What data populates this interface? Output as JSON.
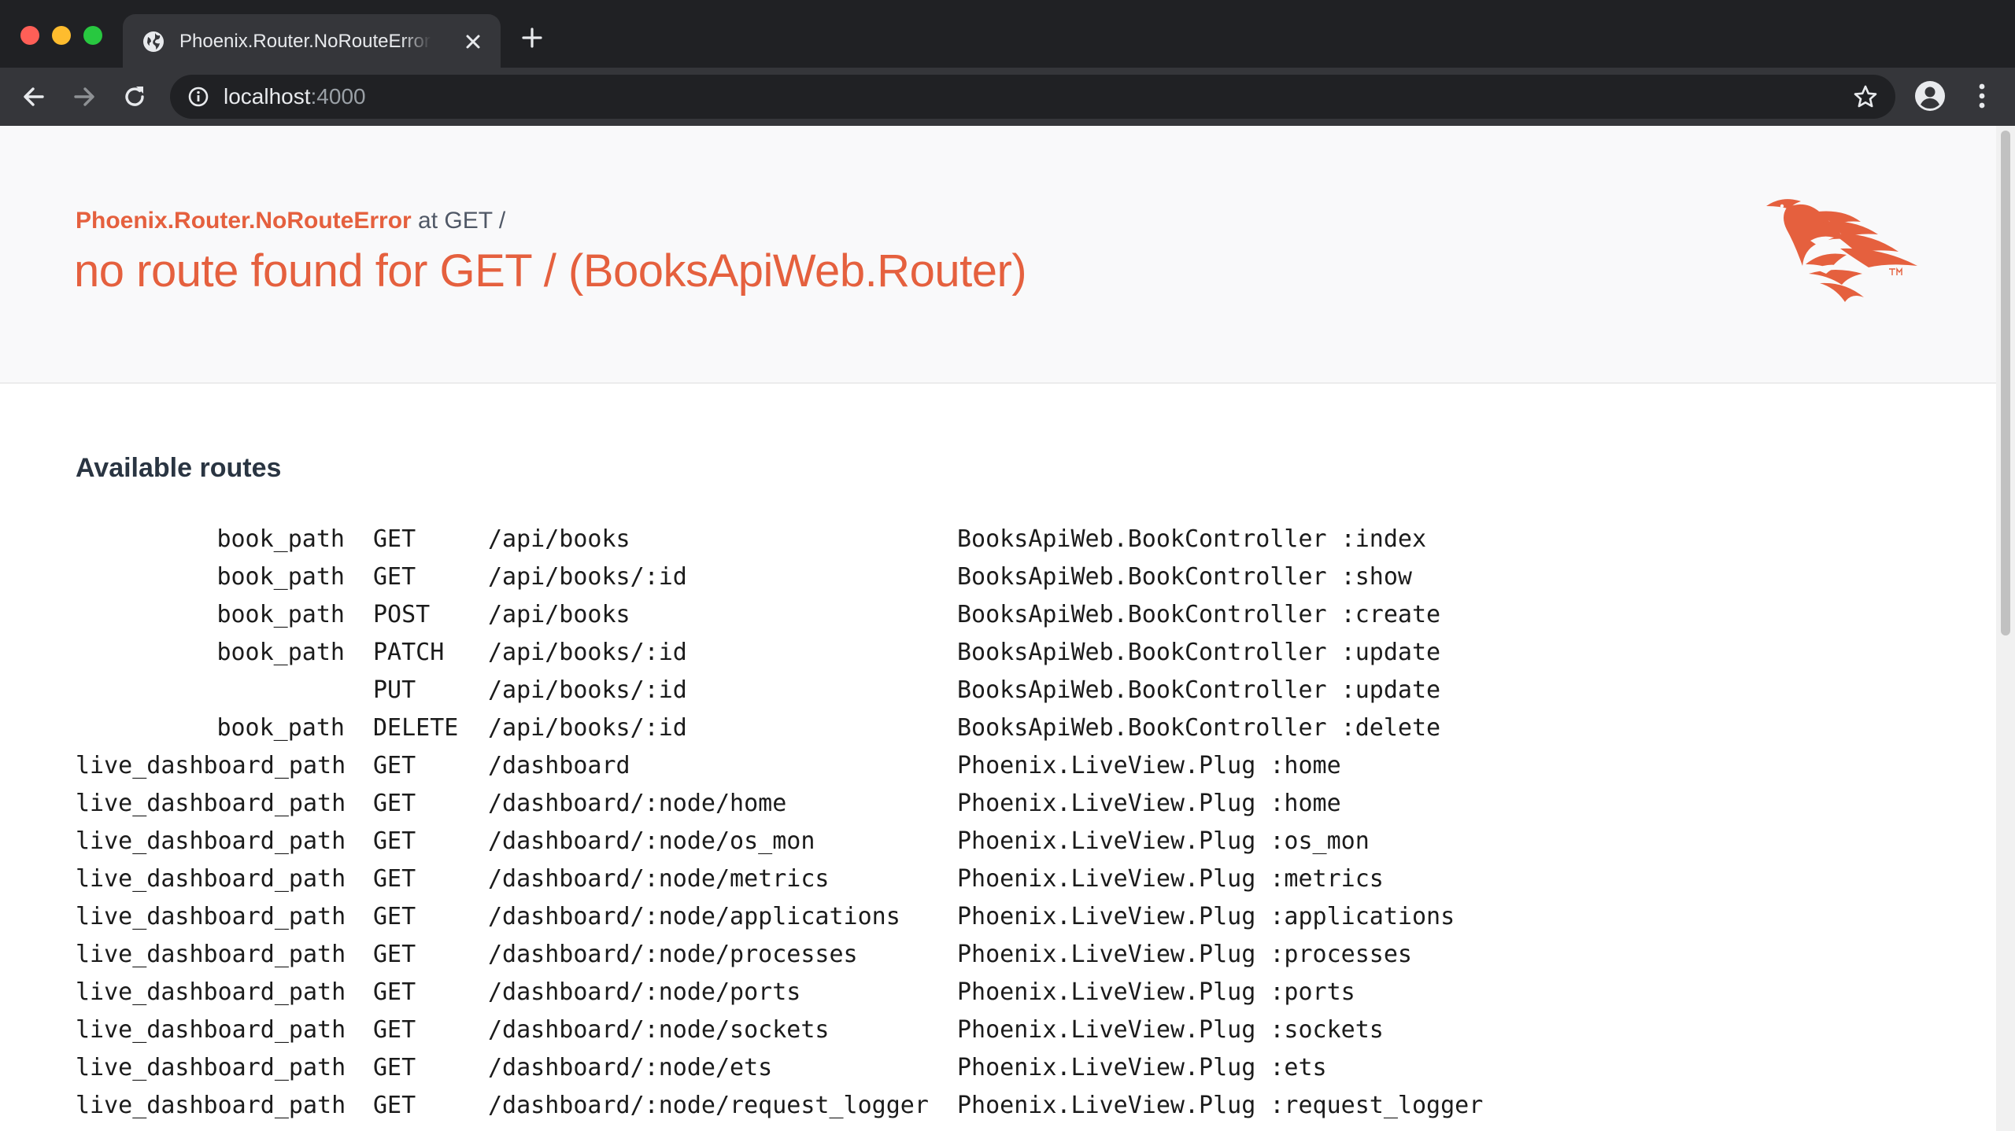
{
  "browser": {
    "tab": {
      "title": "Phoenix.Router.NoRouteError at GET /"
    },
    "address": {
      "host": "localhost",
      "port": ":4000"
    }
  },
  "error": {
    "exception": "Phoenix.Router.NoRouteError",
    "location": " at GET /",
    "message": "no route found for GET / (BooksApiWeb.Router)"
  },
  "routes_section": {
    "title": "Available routes",
    "routes": [
      {
        "helper": "book_path",
        "verb": "GET",
        "path": "/api/books",
        "plug": "BooksApiWeb.BookController :index"
      },
      {
        "helper": "book_path",
        "verb": "GET",
        "path": "/api/books/:id",
        "plug": "BooksApiWeb.BookController :show"
      },
      {
        "helper": "book_path",
        "verb": "POST",
        "path": "/api/books",
        "plug": "BooksApiWeb.BookController :create"
      },
      {
        "helper": "book_path",
        "verb": "PATCH",
        "path": "/api/books/:id",
        "plug": "BooksApiWeb.BookController :update"
      },
      {
        "helper": "",
        "verb": "PUT",
        "path": "/api/books/:id",
        "plug": "BooksApiWeb.BookController :update"
      },
      {
        "helper": "book_path",
        "verb": "DELETE",
        "path": "/api/books/:id",
        "plug": "BooksApiWeb.BookController :delete"
      },
      {
        "helper": "live_dashboard_path",
        "verb": "GET",
        "path": "/dashboard",
        "plug": "Phoenix.LiveView.Plug :home"
      },
      {
        "helper": "live_dashboard_path",
        "verb": "GET",
        "path": "/dashboard/:node/home",
        "plug": "Phoenix.LiveView.Plug :home"
      },
      {
        "helper": "live_dashboard_path",
        "verb": "GET",
        "path": "/dashboard/:node/os_mon",
        "plug": "Phoenix.LiveView.Plug :os_mon"
      },
      {
        "helper": "live_dashboard_path",
        "verb": "GET",
        "path": "/dashboard/:node/metrics",
        "plug": "Phoenix.LiveView.Plug :metrics"
      },
      {
        "helper": "live_dashboard_path",
        "verb": "GET",
        "path": "/dashboard/:node/applications",
        "plug": "Phoenix.LiveView.Plug :applications"
      },
      {
        "helper": "live_dashboard_path",
        "verb": "GET",
        "path": "/dashboard/:node/processes",
        "plug": "Phoenix.LiveView.Plug :processes"
      },
      {
        "helper": "live_dashboard_path",
        "verb": "GET",
        "path": "/dashboard/:node/ports",
        "plug": "Phoenix.LiveView.Plug :ports"
      },
      {
        "helper": "live_dashboard_path",
        "verb": "GET",
        "path": "/dashboard/:node/sockets",
        "plug": "Phoenix.LiveView.Plug :sockets"
      },
      {
        "helper": "live_dashboard_path",
        "verb": "GET",
        "path": "/dashboard/:node/ets",
        "plug": "Phoenix.LiveView.Plug :ets"
      },
      {
        "helper": "live_dashboard_path",
        "verb": "GET",
        "path": "/dashboard/:node/request_logger",
        "plug": "Phoenix.LiveView.Plug :request_logger"
      }
    ]
  },
  "icons": {
    "tab_favicon": "globe-icon",
    "tab_close": "close-icon",
    "new_tab": "plus-icon",
    "back": "arrow-left-icon",
    "forward": "arrow-right-icon",
    "reload": "reload-icon",
    "site_info": "info-icon",
    "bookmark": "star-icon",
    "profile": "account-icon",
    "menu": "kebab-menu-icon",
    "logo": "phoenix-logo"
  },
  "colors": {
    "accent": "#e5603e",
    "chrome_dark": "#202124",
    "chrome_toolbar": "#35363a",
    "heading": "#2a3542"
  }
}
